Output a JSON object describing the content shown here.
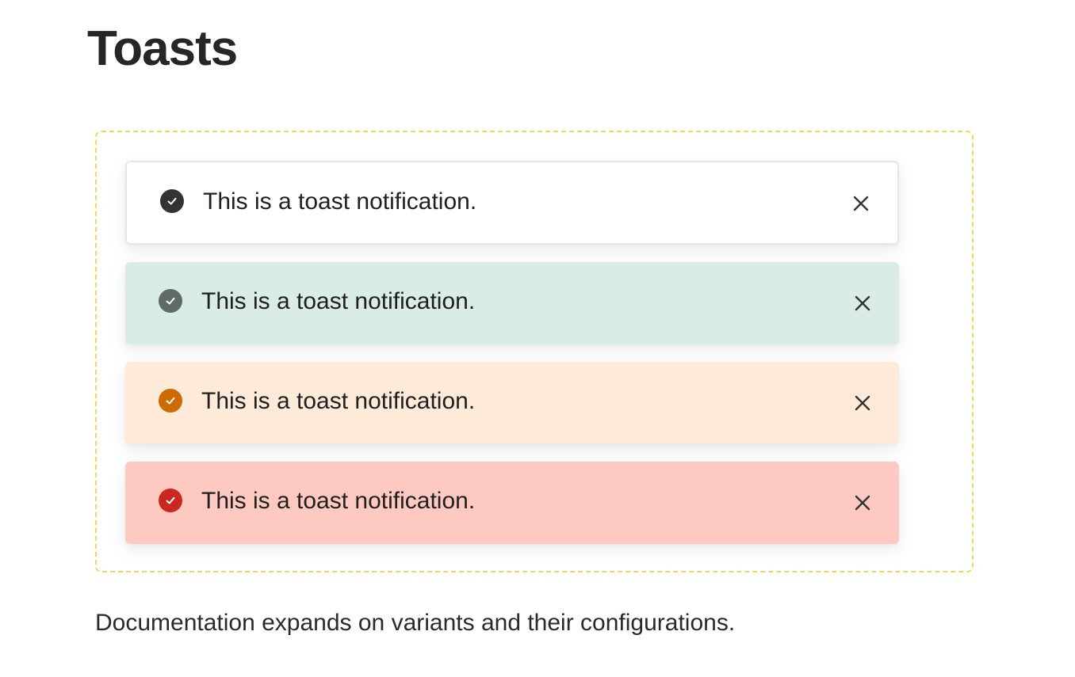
{
  "page": {
    "title": "Toasts",
    "caption": "Documentation expands on variants and their configurations."
  },
  "toasts": [
    {
      "variant": "default",
      "icon": "check-circle-icon",
      "icon_color": "#333333",
      "message": "This is a toast notification.",
      "close_icon": "close-icon"
    },
    {
      "variant": "success",
      "icon": "check-circle-icon",
      "icon_color": "#5f6b66",
      "message": "This is a toast notification.",
      "close_icon": "close-icon"
    },
    {
      "variant": "warning",
      "icon": "check-circle-icon",
      "icon_color": "#cc6a05",
      "message": "This is a toast notification.",
      "close_icon": "close-icon"
    },
    {
      "variant": "error",
      "icon": "check-circle-icon",
      "icon_color": "#c8281f",
      "message": "This is a toast notification.",
      "close_icon": "close-icon"
    }
  ],
  "colors": {
    "frame_border": "#f2d75a",
    "default_bg": "#ffffff",
    "success_bg": "#d9ece5",
    "warning_bg": "#feead8",
    "error_bg": "#fdc9c1"
  }
}
